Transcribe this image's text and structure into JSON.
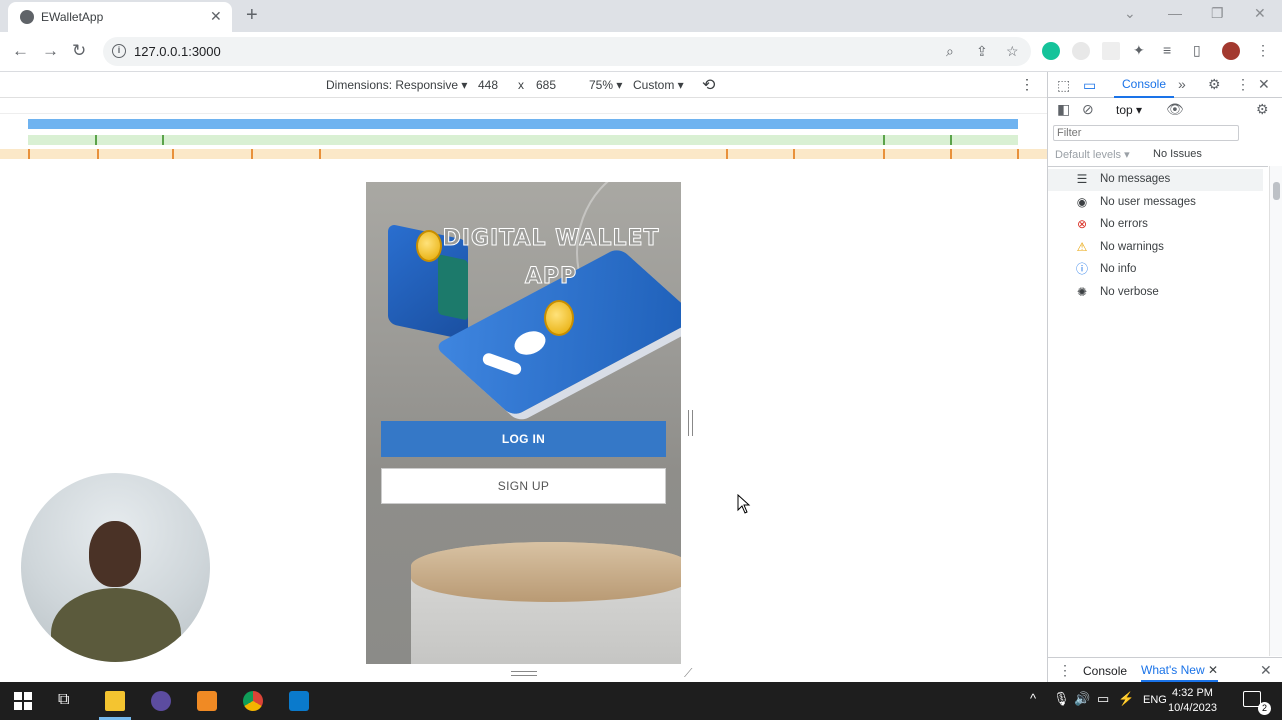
{
  "browser": {
    "tab_title": "EWalletApp",
    "url": "127.0.0.1:3000"
  },
  "device_toolbar": {
    "dimensions_label": "Dimensions: Responsive",
    "width": "448",
    "times": "x",
    "height": "685",
    "zoom": "75%",
    "throttle": "Custom"
  },
  "app": {
    "title": "DIGITAL WALLET APP",
    "login_label": "LOG IN",
    "signup_label": "SIGN UP"
  },
  "devtools": {
    "console_tab": "Console",
    "context": "top",
    "filter_placeholder": "Filter",
    "default_levels": "Default levels",
    "issues": "No Issues",
    "messages": [
      {
        "label": "No messages",
        "icon": "list-icon"
      },
      {
        "label": "No user messages",
        "icon": "user-icon"
      },
      {
        "label": "No errors",
        "icon": "error-icon"
      },
      {
        "label": "No warnings",
        "icon": "warning-icon"
      },
      {
        "label": "No info",
        "icon": "info-icon"
      },
      {
        "label": "No verbose",
        "icon": "bug-icon"
      }
    ],
    "drawer_console": "Console",
    "drawer_whats_new": "What's New"
  },
  "taskbar": {
    "lang": "ENG",
    "time": "4:32 PM",
    "date": "10/4/2023",
    "notifications": "2"
  },
  "colors": {
    "login_button": "#3578c7",
    "devtools_accent": "#1a73e8",
    "media_bar": "#6fb3f0"
  }
}
